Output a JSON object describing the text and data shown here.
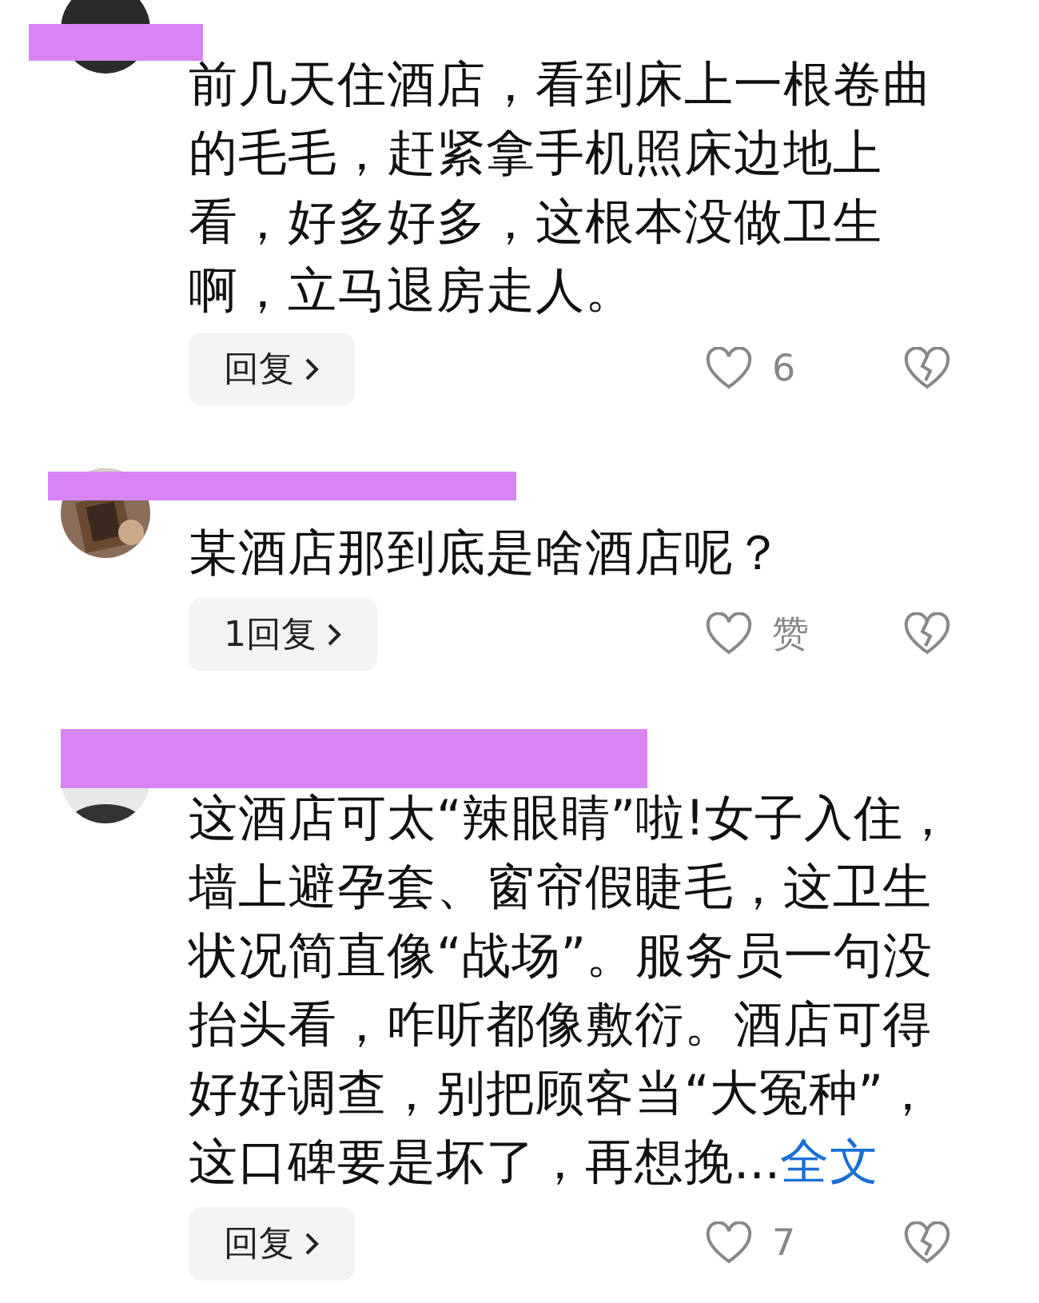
{
  "comments": [
    {
      "redacted": true,
      "avatar": {
        "kind": "dark"
      },
      "text": "前几天住酒店，看到床上一根卷曲的毛毛，赶紧拿手机照床边地上看，好多好多，这根本没做卫生啊，立马退房走人。",
      "reply_label": "回复",
      "like_count": "6"
    },
    {
      "redacted": true,
      "text": "某酒店那到底是啥酒店呢？",
      "reply_label": "1回复",
      "like_count": "赞"
    },
    {
      "redacted": true,
      "avatar": {
        "kind": "person"
      },
      "text": "这酒店可太“辣眼睛”啦!女子入住，墙上避孕套、窗帘假睫毛，这卫生状况简直像“战场”。服务员一句没抬头看，咋听都像敷衍。酒店可得好好调查，别把顾客当“大冤种”，这口碑要是坏了，再想挽...",
      "more_link": "全文",
      "reply_label": "回复",
      "like_count": "7"
    }
  ]
}
